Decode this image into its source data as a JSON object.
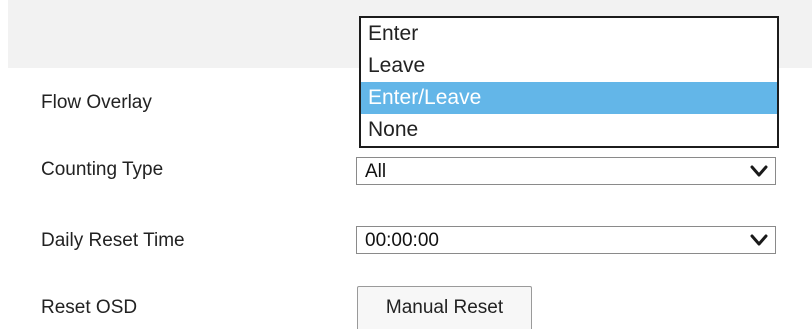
{
  "form": {
    "flow_overlay": {
      "label": "Flow Overlay",
      "options": [
        "Enter",
        "Leave",
        "Enter/Leave",
        "None"
      ],
      "highlighted_option": "Enter/Leave"
    },
    "counting_type": {
      "label": "Counting Type",
      "value": "All"
    },
    "daily_reset_time": {
      "label": "Daily Reset Time",
      "value": "00:00:00"
    },
    "reset_osd": {
      "label": "Reset OSD",
      "button_label": "Manual Reset"
    }
  },
  "colors": {
    "highlight": "#63b6e8",
    "header_band": "#f2f2f2"
  }
}
